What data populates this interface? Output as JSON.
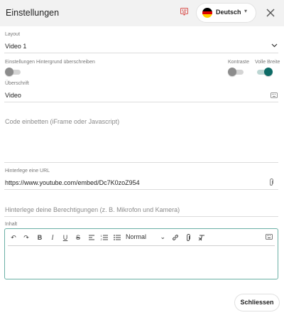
{
  "header": {
    "title": "Einstellungen",
    "badge_icon": "translate-badge-icon",
    "language": {
      "label": "Deutsch",
      "flag_colors": [
        "#000000",
        "#dd0000",
        "#ffce00"
      ],
      "caret": "▾"
    },
    "close_icon": "close-icon"
  },
  "layout": {
    "label": "Layout",
    "value": "Video 1"
  },
  "toggles": {
    "override_bg": {
      "label": "Einstellungen Hintergrund überschreiben",
      "on": false
    },
    "contrast": {
      "label": "Kontraste",
      "on": false
    },
    "full_width": {
      "label": "Volle Breite",
      "on": true
    }
  },
  "heading": {
    "label": "Überschrift",
    "value": "Video"
  },
  "embed_code": {
    "placeholder": "Code einbetten (iFrame oder Javascript)"
  },
  "url": {
    "label": "Hinterlege eine URL",
    "value": "https://www.youtube.com/embed/Dc7K0zoZ954"
  },
  "permissions": {
    "placeholder": "Hinterlege deine Berechtigungen (z. B. Mikrofon und Kamera)"
  },
  "content": {
    "label": "Inhalt",
    "toolbar": {
      "undo": "↶",
      "redo": "↷",
      "bold": "B",
      "italic": "I",
      "underline": "U",
      "strike": "S",
      "format": "Normal",
      "format_caret": "⌄"
    }
  },
  "footer": {
    "close_label": "Schliessen"
  },
  "colors": {
    "accent": "#0d6b66",
    "badge": "#d9534f",
    "editor_border": "#6ab0a5"
  }
}
